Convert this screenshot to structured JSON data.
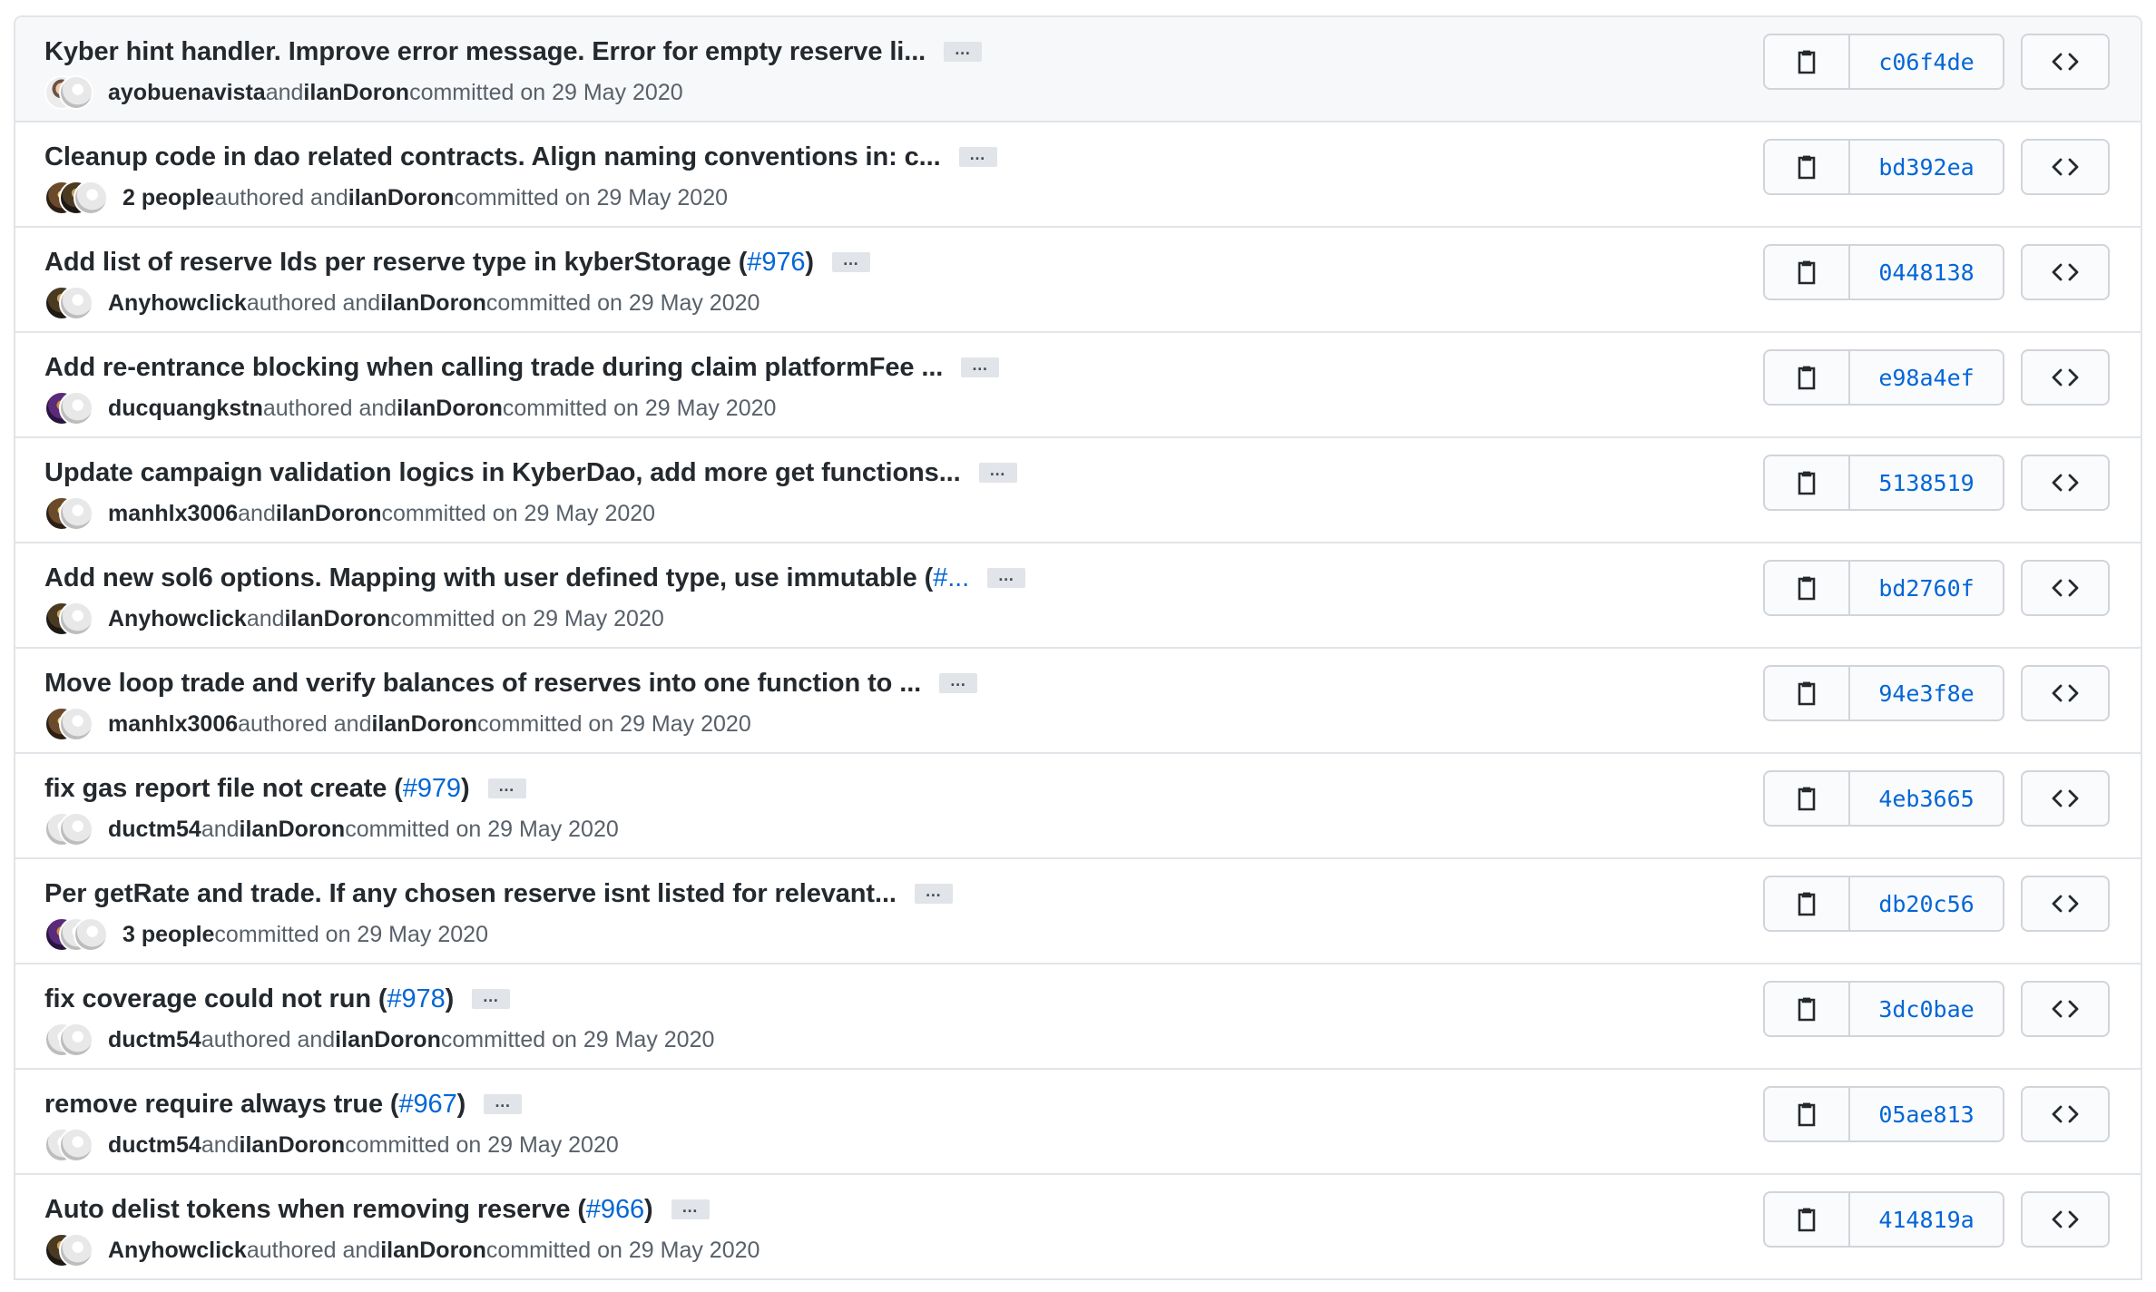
{
  "commits": [
    {
      "title": "Kyber hint handler. Improve error message. Error for empty reserve li...",
      "pr": "",
      "suffix": "",
      "avatars": [
        "photo",
        "light"
      ],
      "people": "",
      "author": "ayobuenavista",
      "verb": " and ",
      "committer": "ilanDoron",
      "committed": " committed on 29 May 2020",
      "sha": "c06f4de"
    },
    {
      "title": "Cleanup code in dao related contracts. Align naming conventions in: c...",
      "pr": "",
      "suffix": "",
      "avatars": [
        "brown",
        "dark",
        "light"
      ],
      "people": "2 people",
      "author": "",
      "verb": " authored and ",
      "committer": "ilanDoron",
      "committed": " committed on 29 May 2020",
      "sha": "bd392ea"
    },
    {
      "title": "Add list of reserve Ids per reserve type in kyberStorage (",
      "pr": "#976",
      "suffix": ")",
      "avatars": [
        "dark",
        "light"
      ],
      "people": "",
      "author": "Anyhowclick",
      "verb": " authored and ",
      "committer": "ilanDoron",
      "committed": " committed on 29 May 2020",
      "sha": "0448138"
    },
    {
      "title": "Add re-entrance blocking when calling trade during claim platformFee ...",
      "pr": "",
      "suffix": "",
      "avatars": [
        "purple",
        "light"
      ],
      "people": "",
      "author": "ducquangkstn",
      "verb": " authored and ",
      "committer": "ilanDoron",
      "committed": " committed on 29 May 2020",
      "sha": "e98a4ef"
    },
    {
      "title": "Update campaign validation logics in KyberDao, add more get functions...",
      "pr": "",
      "suffix": "",
      "avatars": [
        "brown",
        "light"
      ],
      "people": "",
      "author": "manhlx3006",
      "verb": " and ",
      "committer": "ilanDoron",
      "committed": " committed on 29 May 2020",
      "sha": "5138519"
    },
    {
      "title": "Add new sol6 options. Mapping with user defined type, use immutable (",
      "pr": "#...",
      "suffix": "",
      "avatars": [
        "dark",
        "light"
      ],
      "people": "",
      "author": "Anyhowclick",
      "verb": " and ",
      "committer": "ilanDoron",
      "committed": " committed on 29 May 2020",
      "sha": "bd2760f"
    },
    {
      "title": "Move loop trade and verify balances of reserves into one function to ...",
      "pr": "",
      "suffix": "",
      "avatars": [
        "brown",
        "light"
      ],
      "people": "",
      "author": "manhlx3006",
      "verb": " authored and ",
      "committer": "ilanDoron",
      "committed": " committed on 29 May 2020",
      "sha": "94e3f8e"
    },
    {
      "title": "fix gas report file not create (",
      "pr": "#979",
      "suffix": ")",
      "avatars": [
        "light",
        "light"
      ],
      "people": "",
      "author": "ductm54",
      "verb": " and ",
      "committer": "ilanDoron",
      "committed": " committed on 29 May 2020",
      "sha": "4eb3665"
    },
    {
      "title": "Per getRate and trade. If any chosen reserve isnt listed for relevant...",
      "pr": "",
      "suffix": "",
      "avatars": [
        "purple",
        "light",
        "light"
      ],
      "people": "3 people",
      "author": "",
      "verb": "",
      "committer": "",
      "committed": " committed on 29 May 2020",
      "sha": "db20c56"
    },
    {
      "title": "fix coverage could not run (",
      "pr": "#978",
      "suffix": ")",
      "avatars": [
        "light",
        "light"
      ],
      "people": "",
      "author": "ductm54",
      "verb": " authored and ",
      "committer": "ilanDoron",
      "committed": " committed on 29 May 2020",
      "sha": "3dc0bae"
    },
    {
      "title": "remove require always true (",
      "pr": "#967",
      "suffix": ")",
      "avatars": [
        "light",
        "light"
      ],
      "people": "",
      "author": "ductm54",
      "verb": " and ",
      "committer": "ilanDoron",
      "committed": " committed on 29 May 2020",
      "sha": "05ae813"
    },
    {
      "title": "Auto delist tokens when removing reserve (",
      "pr": "#966",
      "suffix": ")",
      "avatars": [
        "dark",
        "light"
      ],
      "people": "",
      "author": "Anyhowclick",
      "verb": " authored and ",
      "committer": "ilanDoron",
      "committed": " committed on 29 May 2020",
      "sha": "414819a"
    }
  ],
  "ellipsis_label": "…",
  "icons": {
    "copy": "clipboard-icon",
    "browse": "code-icon"
  },
  "colors": {
    "link": "#0366d6",
    "text": "#24292e",
    "muted": "#586069",
    "border": "#e1e4e8"
  }
}
